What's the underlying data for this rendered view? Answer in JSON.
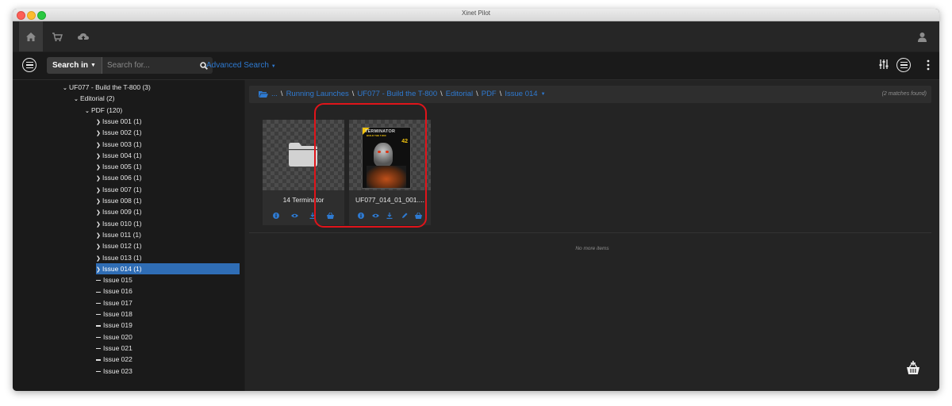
{
  "window": {
    "title": "Xinet Pilot"
  },
  "search": {
    "scope_label": "Search in",
    "placeholder": "Search for...",
    "advanced_label": "Advanced Search"
  },
  "tree": {
    "rows": [
      {
        "label": "UF077 - Build the T-800 (3)",
        "expanded": true
      },
      {
        "label": "Editorial (2)",
        "expanded": true
      },
      {
        "label": "PDF (120)",
        "expanded": true
      },
      {
        "label": "Issue 001 (1)"
      },
      {
        "label": "Issue 002 (1)"
      },
      {
        "label": "Issue 003 (1)"
      },
      {
        "label": "Issue 004 (1)"
      },
      {
        "label": "Issue 005 (1)"
      },
      {
        "label": "Issue 006 (1)"
      },
      {
        "label": "Issue 007 (1)"
      },
      {
        "label": "Issue 008 (1)"
      },
      {
        "label": "Issue 009 (1)"
      },
      {
        "label": "Issue 010 (1)"
      },
      {
        "label": "Issue 011 (1)"
      },
      {
        "label": "Issue 012 (1)"
      },
      {
        "label": "Issue 013 (1)"
      },
      {
        "label": "Issue 014 (1)",
        "selected": true
      },
      {
        "label": "Issue 015"
      },
      {
        "label": "Issue 016"
      },
      {
        "label": "Issue 017"
      },
      {
        "label": "Issue 018"
      },
      {
        "label": "Issue 019"
      },
      {
        "label": "Issue 020"
      },
      {
        "label": "Issue 021"
      },
      {
        "label": "Issue 022"
      },
      {
        "label": "Issue 023"
      }
    ]
  },
  "breadcrumb": {
    "items": [
      "...",
      "Running Launches",
      "UF077 - Build the T-800",
      "Editorial",
      "PDF",
      "Issue 014"
    ],
    "matches": "(2 matches found)"
  },
  "cards": [
    {
      "label": "14 Terminator",
      "kind": "folder",
      "actions": [
        "info-icon",
        "eye-icon",
        "download-icon",
        "basket-icon"
      ]
    },
    {
      "label": "UF077_014_01_001....",
      "kind": "pdf",
      "actions": [
        "info-icon",
        "eye-icon",
        "download-icon",
        "pencil-icon",
        "basket-icon"
      ]
    }
  ],
  "thumbnail": {
    "title": "TERMINATOR",
    "subtitle": "BUILD THE T-800",
    "issue": "42"
  },
  "no_more": "No more items",
  "colors": {
    "accent": "#2e7ad1",
    "selection": "#2f6db5",
    "highlight": "#e0141a"
  }
}
